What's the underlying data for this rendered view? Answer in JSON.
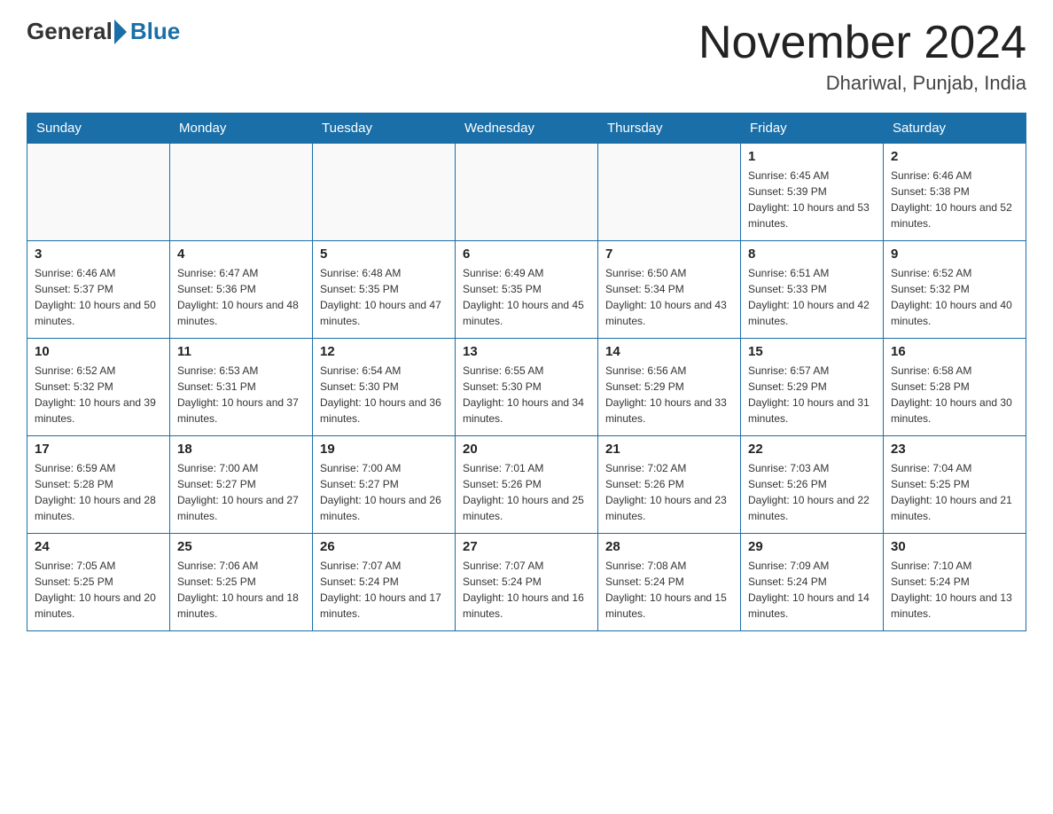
{
  "header": {
    "logo": {
      "general": "General",
      "blue": "Blue"
    },
    "title": "November 2024",
    "location": "Dhariwal, Punjab, India"
  },
  "calendar": {
    "days_of_week": [
      "Sunday",
      "Monday",
      "Tuesday",
      "Wednesday",
      "Thursday",
      "Friday",
      "Saturday"
    ],
    "weeks": [
      [
        {
          "day": "",
          "info": ""
        },
        {
          "day": "",
          "info": ""
        },
        {
          "day": "",
          "info": ""
        },
        {
          "day": "",
          "info": ""
        },
        {
          "day": "",
          "info": ""
        },
        {
          "day": "1",
          "info": "Sunrise: 6:45 AM\nSunset: 5:39 PM\nDaylight: 10 hours and 53 minutes."
        },
        {
          "day": "2",
          "info": "Sunrise: 6:46 AM\nSunset: 5:38 PM\nDaylight: 10 hours and 52 minutes."
        }
      ],
      [
        {
          "day": "3",
          "info": "Sunrise: 6:46 AM\nSunset: 5:37 PM\nDaylight: 10 hours and 50 minutes."
        },
        {
          "day": "4",
          "info": "Sunrise: 6:47 AM\nSunset: 5:36 PM\nDaylight: 10 hours and 48 minutes."
        },
        {
          "day": "5",
          "info": "Sunrise: 6:48 AM\nSunset: 5:35 PM\nDaylight: 10 hours and 47 minutes."
        },
        {
          "day": "6",
          "info": "Sunrise: 6:49 AM\nSunset: 5:35 PM\nDaylight: 10 hours and 45 minutes."
        },
        {
          "day": "7",
          "info": "Sunrise: 6:50 AM\nSunset: 5:34 PM\nDaylight: 10 hours and 43 minutes."
        },
        {
          "day": "8",
          "info": "Sunrise: 6:51 AM\nSunset: 5:33 PM\nDaylight: 10 hours and 42 minutes."
        },
        {
          "day": "9",
          "info": "Sunrise: 6:52 AM\nSunset: 5:32 PM\nDaylight: 10 hours and 40 minutes."
        }
      ],
      [
        {
          "day": "10",
          "info": "Sunrise: 6:52 AM\nSunset: 5:32 PM\nDaylight: 10 hours and 39 minutes."
        },
        {
          "day": "11",
          "info": "Sunrise: 6:53 AM\nSunset: 5:31 PM\nDaylight: 10 hours and 37 minutes."
        },
        {
          "day": "12",
          "info": "Sunrise: 6:54 AM\nSunset: 5:30 PM\nDaylight: 10 hours and 36 minutes."
        },
        {
          "day": "13",
          "info": "Sunrise: 6:55 AM\nSunset: 5:30 PM\nDaylight: 10 hours and 34 minutes."
        },
        {
          "day": "14",
          "info": "Sunrise: 6:56 AM\nSunset: 5:29 PM\nDaylight: 10 hours and 33 minutes."
        },
        {
          "day": "15",
          "info": "Sunrise: 6:57 AM\nSunset: 5:29 PM\nDaylight: 10 hours and 31 minutes."
        },
        {
          "day": "16",
          "info": "Sunrise: 6:58 AM\nSunset: 5:28 PM\nDaylight: 10 hours and 30 minutes."
        }
      ],
      [
        {
          "day": "17",
          "info": "Sunrise: 6:59 AM\nSunset: 5:28 PM\nDaylight: 10 hours and 28 minutes."
        },
        {
          "day": "18",
          "info": "Sunrise: 7:00 AM\nSunset: 5:27 PM\nDaylight: 10 hours and 27 minutes."
        },
        {
          "day": "19",
          "info": "Sunrise: 7:00 AM\nSunset: 5:27 PM\nDaylight: 10 hours and 26 minutes."
        },
        {
          "day": "20",
          "info": "Sunrise: 7:01 AM\nSunset: 5:26 PM\nDaylight: 10 hours and 25 minutes."
        },
        {
          "day": "21",
          "info": "Sunrise: 7:02 AM\nSunset: 5:26 PM\nDaylight: 10 hours and 23 minutes."
        },
        {
          "day": "22",
          "info": "Sunrise: 7:03 AM\nSunset: 5:26 PM\nDaylight: 10 hours and 22 minutes."
        },
        {
          "day": "23",
          "info": "Sunrise: 7:04 AM\nSunset: 5:25 PM\nDaylight: 10 hours and 21 minutes."
        }
      ],
      [
        {
          "day": "24",
          "info": "Sunrise: 7:05 AM\nSunset: 5:25 PM\nDaylight: 10 hours and 20 minutes."
        },
        {
          "day": "25",
          "info": "Sunrise: 7:06 AM\nSunset: 5:25 PM\nDaylight: 10 hours and 18 minutes."
        },
        {
          "day": "26",
          "info": "Sunrise: 7:07 AM\nSunset: 5:24 PM\nDaylight: 10 hours and 17 minutes."
        },
        {
          "day": "27",
          "info": "Sunrise: 7:07 AM\nSunset: 5:24 PM\nDaylight: 10 hours and 16 minutes."
        },
        {
          "day": "28",
          "info": "Sunrise: 7:08 AM\nSunset: 5:24 PM\nDaylight: 10 hours and 15 minutes."
        },
        {
          "day": "29",
          "info": "Sunrise: 7:09 AM\nSunset: 5:24 PM\nDaylight: 10 hours and 14 minutes."
        },
        {
          "day": "30",
          "info": "Sunrise: 7:10 AM\nSunset: 5:24 PM\nDaylight: 10 hours and 13 minutes."
        }
      ]
    ]
  }
}
